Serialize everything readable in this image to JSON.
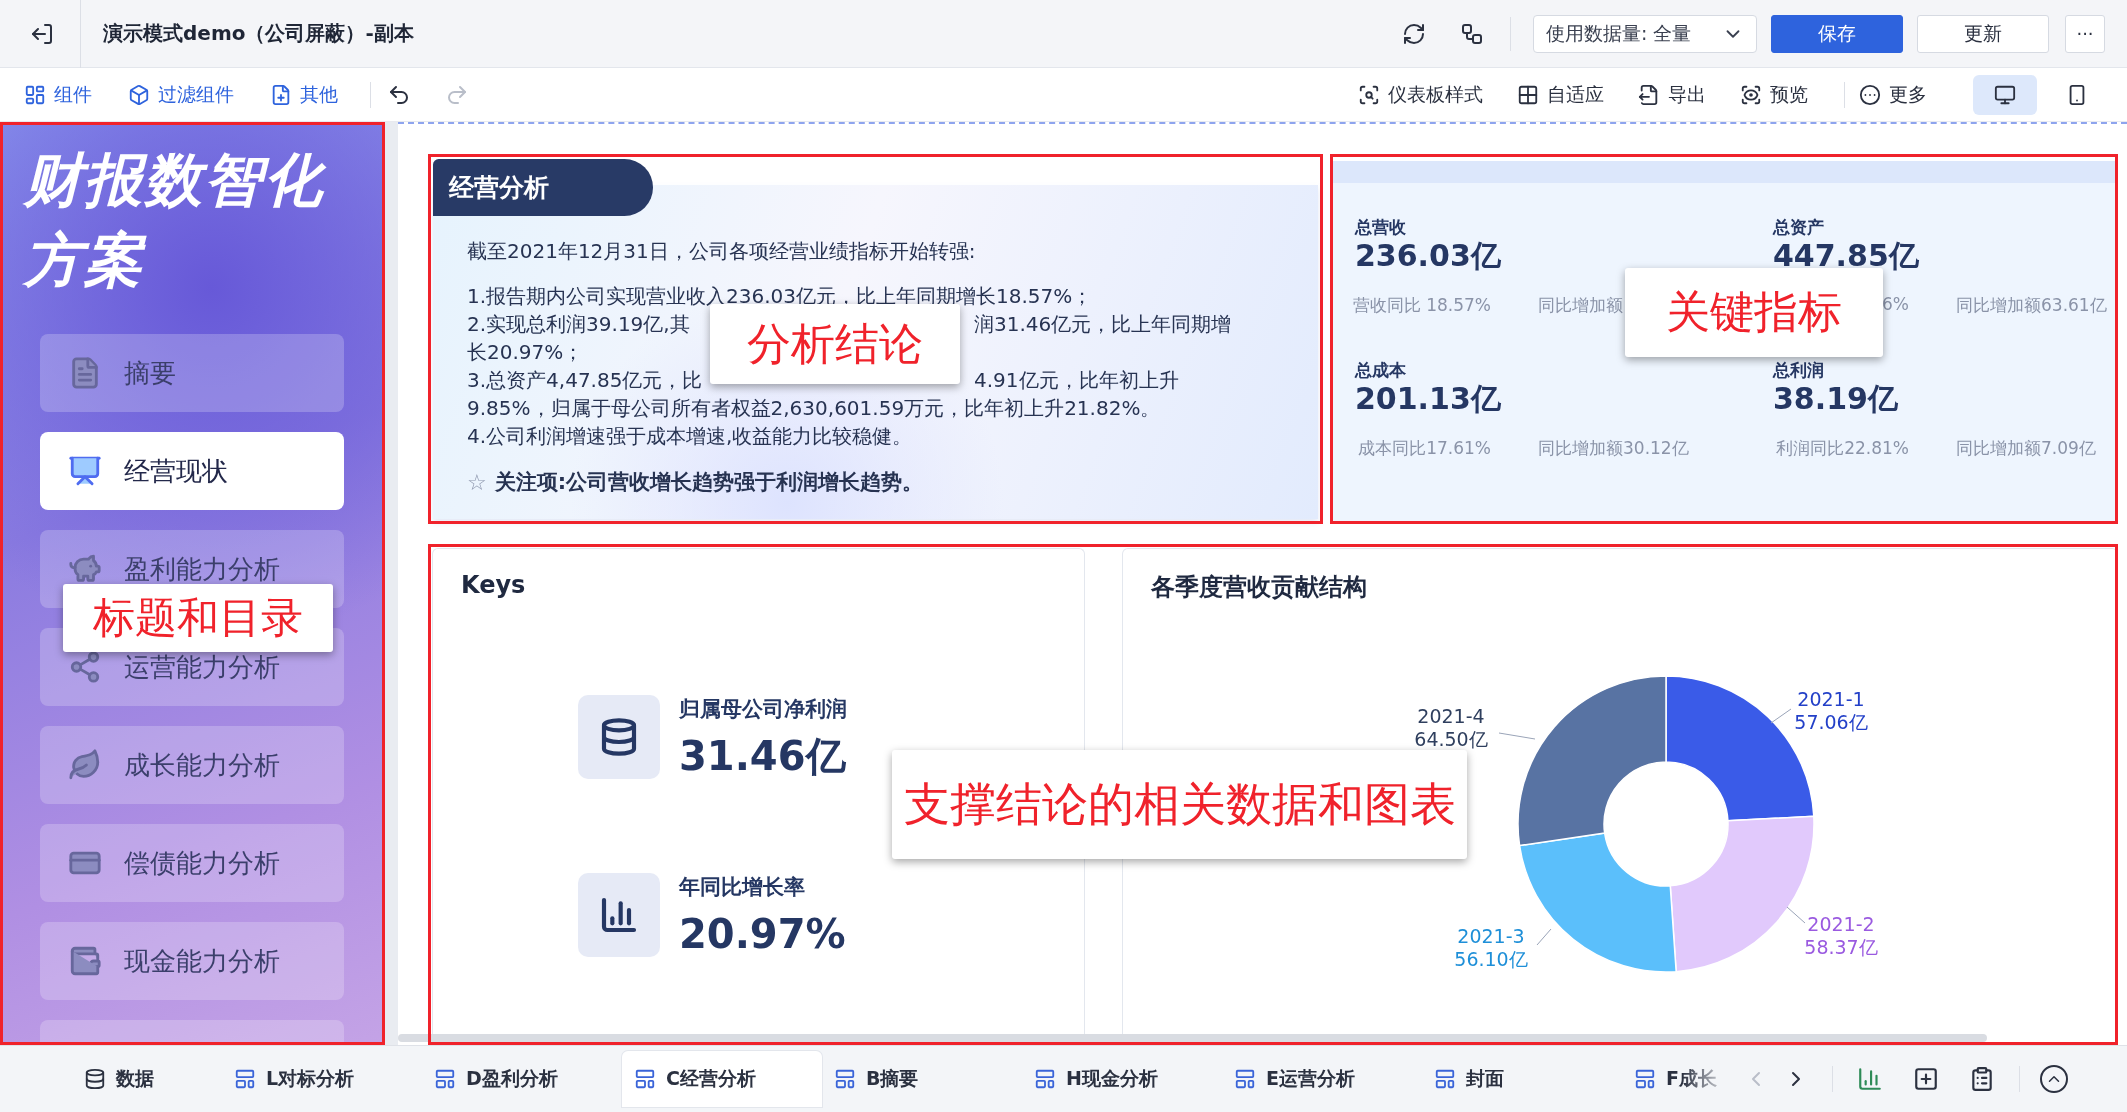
{
  "header": {
    "title": "演示模式demo（公司屏蔽）-副本",
    "data_select": {
      "label": "使用数据量:",
      "value": "全量"
    },
    "buttons": [
      {
        "label": "保存",
        "kind": "primary"
      },
      {
        "label": "更新",
        "kind": "default"
      }
    ],
    "more": "···"
  },
  "toolbar": {
    "left": [
      {
        "label": "组件",
        "kind": "component"
      },
      {
        "label": "过滤组件",
        "kind": "filter"
      },
      {
        "label": "其他",
        "kind": "other"
      }
    ],
    "undo": {
      "disabled": false
    },
    "redo": {
      "disabled": true
    },
    "right": [
      {
        "label": "仪表板样式",
        "kind": "style"
      },
      {
        "label": "自适应",
        "kind": "fit"
      },
      {
        "label": "导出",
        "kind": "export"
      },
      {
        "label": "预览",
        "kind": "preview"
      },
      {
        "label": "更多",
        "kind": "more"
      }
    ],
    "views": [
      {
        "kind": "desktop",
        "selected": true
      },
      {
        "kind": "mobile",
        "selected": false
      }
    ]
  },
  "sidebar": {
    "title": "财报数智化方案",
    "callout": "标题和目录",
    "items": [
      {
        "label": "摘要",
        "kind": "summary",
        "selected": false
      },
      {
        "label": "经营现状",
        "kind": "operation",
        "selected": true
      },
      {
        "label": "盈利能力分析",
        "kind": "profit",
        "selected": false
      },
      {
        "label": "运营能力分析",
        "kind": "ops",
        "selected": false
      },
      {
        "label": "成长能力分析",
        "kind": "growth",
        "selected": false
      },
      {
        "label": "偿债能力分析",
        "kind": "solvency",
        "selected": false
      },
      {
        "label": "现金能力分析",
        "kind": "cash",
        "selected": false
      }
    ]
  },
  "analysis": {
    "tab": "经营分析",
    "callout": "分析结论",
    "intro": "截至2021年12月31日，公司各项经营业绩指标开始转强:",
    "lines": [
      [
        "1.报告期内公司实现营业收入236.03亿元，比上年同期增长18.57%；"
      ],
      [
        "2.实现总利润39.19亿,其",
        "润31.46亿元，比上年同期增"
      ],
      [
        "长20.97%；"
      ],
      [
        "3.总资产4,47.85亿元，比",
        "4.91亿元，比年初上升"
      ],
      [
        "9.85%，归属于母公司所有者权益2,630,601.59万元，比年初上升21.82%。"
      ],
      [
        "4.公司利润增速强于成本增速,收益能力比较稳健。"
      ]
    ],
    "focus": {
      "star": "☆",
      "text": "关注项:公司营收增长趋势强于利润增长趋势。"
    }
  },
  "metrics": {
    "callout": "关键指标",
    "items": [
      {
        "label": "总营收",
        "value": "236.03亿",
        "subs": [
          "营收同比 18.57%",
          "同比增加额"
        ]
      },
      {
        "label": "总资产",
        "value": "447.85亿",
        "subs": [
          "6%",
          "同比增加额63.61亿"
        ]
      },
      {
        "label": "总成本",
        "value": "201.13亿",
        "subs": [
          "成本同比17.61%",
          "同比增加额30.12亿"
        ]
      },
      {
        "label": "总利润",
        "value": "38.19亿",
        "subs": [
          "利润同比22.81%",
          "同比增加额7.09亿"
        ]
      }
    ]
  },
  "support": {
    "callout": "支撑结论的相关数据和图表",
    "keys": {
      "title": "Keys",
      "items": [
        {
          "kind": "database",
          "label": "归属母公司净利润",
          "value": "31.46亿"
        },
        {
          "kind": "growth",
          "label": "年同比增长率",
          "value": "20.97%"
        }
      ]
    },
    "chart": {
      "title": "各季度营收贡献结构",
      "chart_data": {
        "type": "donut",
        "categories": [
          "2021-1",
          "2021-2",
          "2021-3",
          "2021-4"
        ],
        "values": [
          57.06,
          58.37,
          56.1,
          64.5
        ],
        "value_labels": [
          "57.06亿",
          "58.37亿",
          "56.10亿",
          "64.50亿"
        ]
      }
    }
  },
  "bottom": {
    "data_tab": "数据",
    "tabs": [
      {
        "label": "L对标分析",
        "selected": false
      },
      {
        "label": "D盈利分析",
        "selected": false
      },
      {
        "label": "C经营分析",
        "selected": true
      },
      {
        "label": "B摘要",
        "selected": false
      },
      {
        "label": "H现金分析",
        "selected": false
      },
      {
        "label": "E运营分析",
        "selected": false
      },
      {
        "label": "封面",
        "selected": false
      },
      {
        "label": "F成长",
        "selected": false
      }
    ],
    "prev": {
      "disabled": true
    },
    "next": {
      "disabled": false
    }
  }
}
